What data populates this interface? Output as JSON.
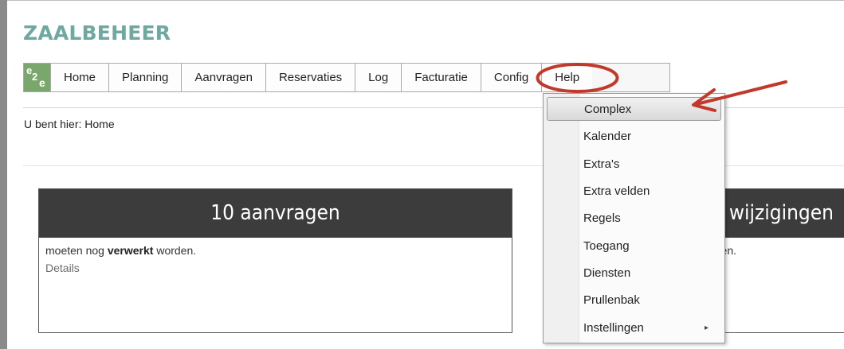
{
  "app": {
    "title": "ZAALBEHEER",
    "logo_text": "e2e"
  },
  "nav": {
    "items": [
      "Home",
      "Planning",
      "Aanvragen",
      "Reservaties",
      "Log",
      "Facturatie",
      "Config",
      "Help"
    ]
  },
  "breadcrumb": "U bent hier: Home",
  "cards": [
    {
      "title": "10 aanvragen",
      "desc_pre": "moeten nog ",
      "desc_bold": "verwerkt",
      "desc_post": " worden.",
      "details": "Details"
    },
    {
      "title": "wijzigingen",
      "desc": "en."
    }
  ],
  "dropdown": {
    "items": [
      "Complex",
      "Kalender",
      "Extra's",
      "Extra velden",
      "Regels",
      "Toegang",
      "Diensten",
      "Prullenbak",
      "Instellingen"
    ],
    "highlighted": "Complex",
    "submenu_arrow": "▸"
  },
  "annotation": {
    "color": "#c0392b"
  },
  "colors": {
    "title": "#6fa8a0",
    "card_header": "#3c3c3c",
    "logo": "#7aa76b"
  }
}
